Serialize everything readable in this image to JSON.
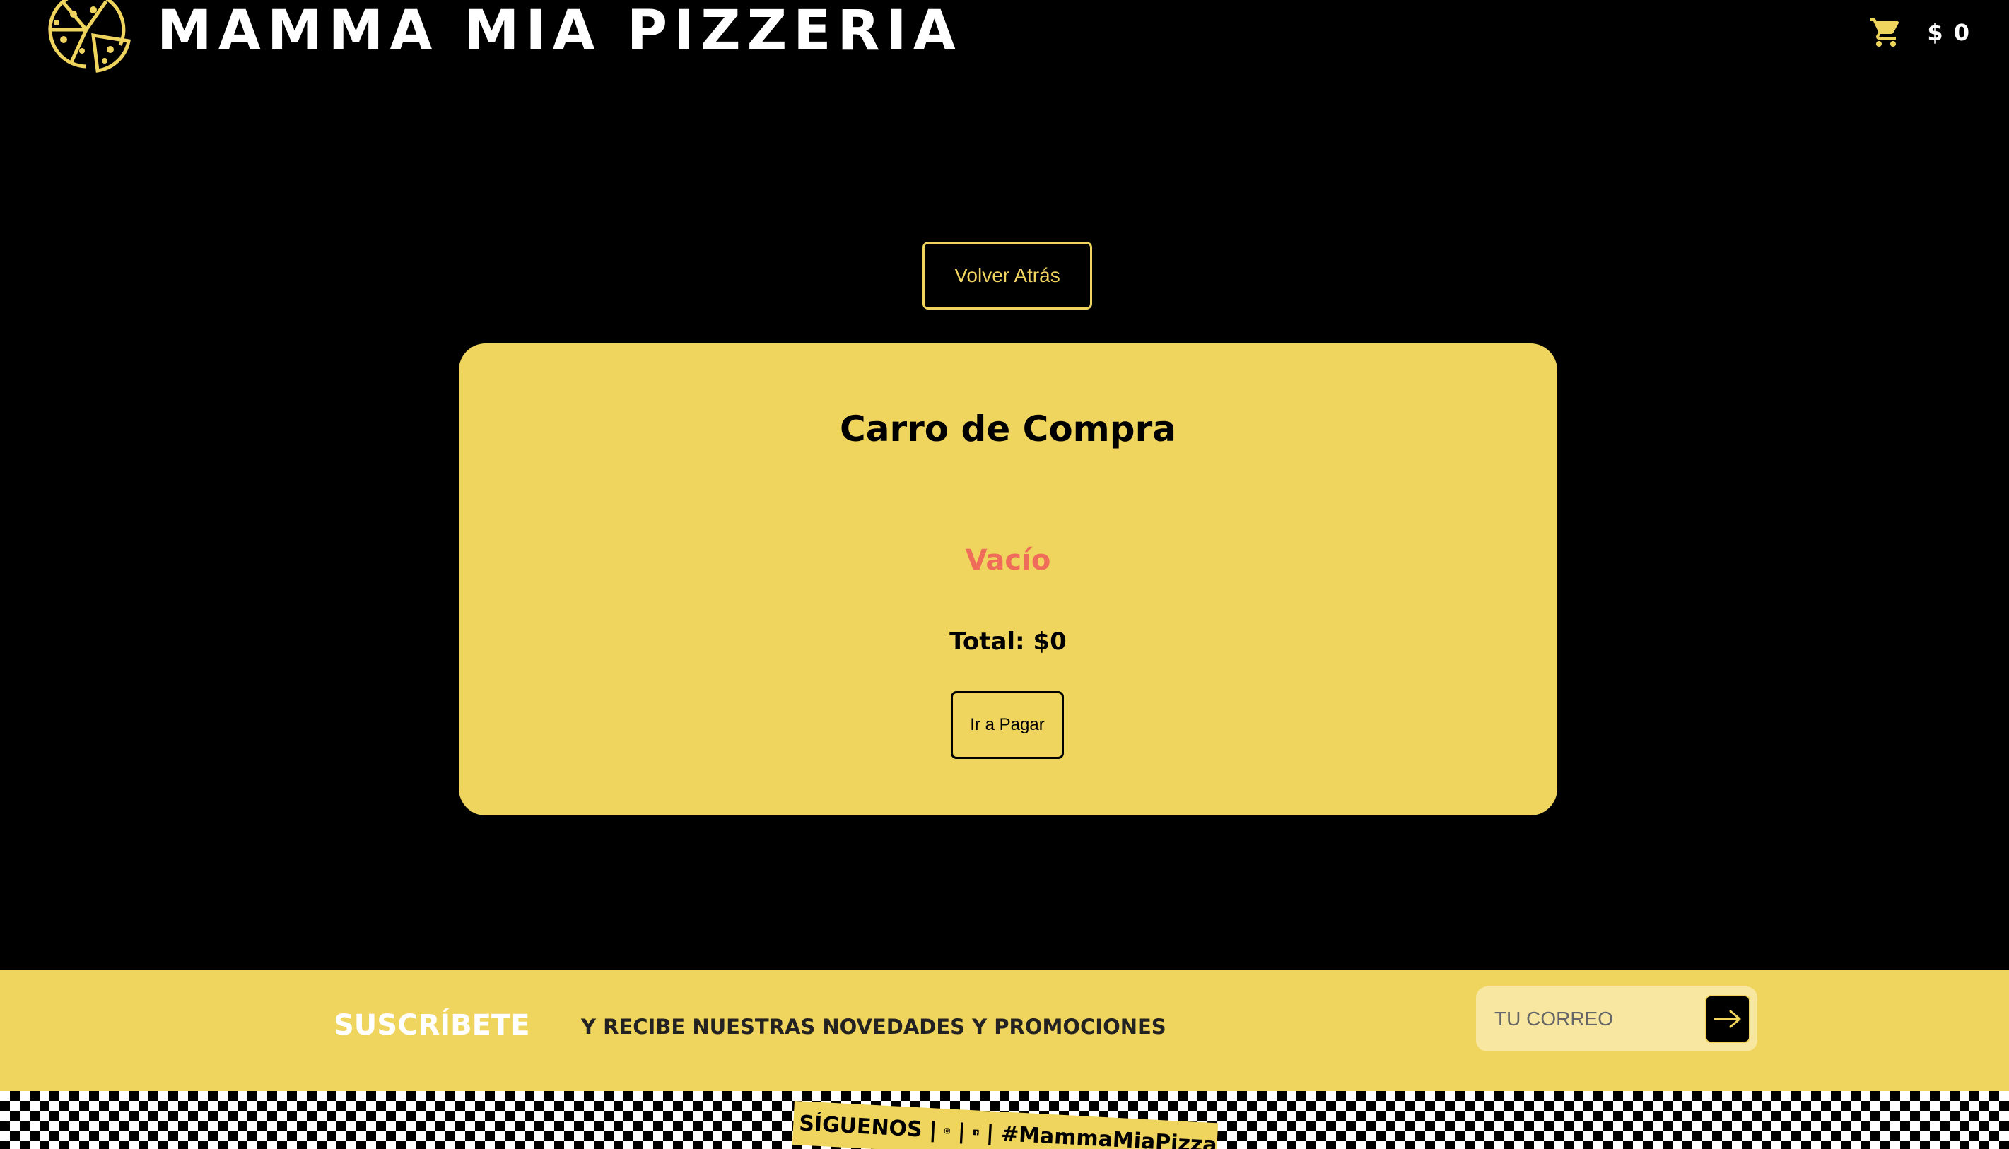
{
  "header": {
    "brand": "MAMMA MIA PIZZERIA",
    "cart_total": "$ 0",
    "logo_icon": "pizza-icon",
    "cart_icon": "shopping-cart-icon"
  },
  "main": {
    "back_button": "Volver Atrás",
    "cart": {
      "title": "Carro de Compra",
      "empty_label": "Vacío",
      "total": "Total: $0",
      "pay_button": "Ir a Pagar"
    }
  },
  "subscribe": {
    "title": "SUSCRÍBETE",
    "text": "Y RECIBE NUESTRAS NOVEDADES Y PROMOCIONES",
    "email_placeholder": "TU CORREO",
    "submit_icon": "arrow-right-icon"
  },
  "footer": {
    "follow_label": "SÍGUENOS",
    "separator": "|",
    "hashtag": "#MammaMiaPizza",
    "social_icons": [
      "instagram-icon",
      "facebook-icon"
    ]
  },
  "colors": {
    "background": "#000000",
    "accent": "#efd45e",
    "empty_text": "#ef6b5a",
    "white": "#ffffff"
  }
}
